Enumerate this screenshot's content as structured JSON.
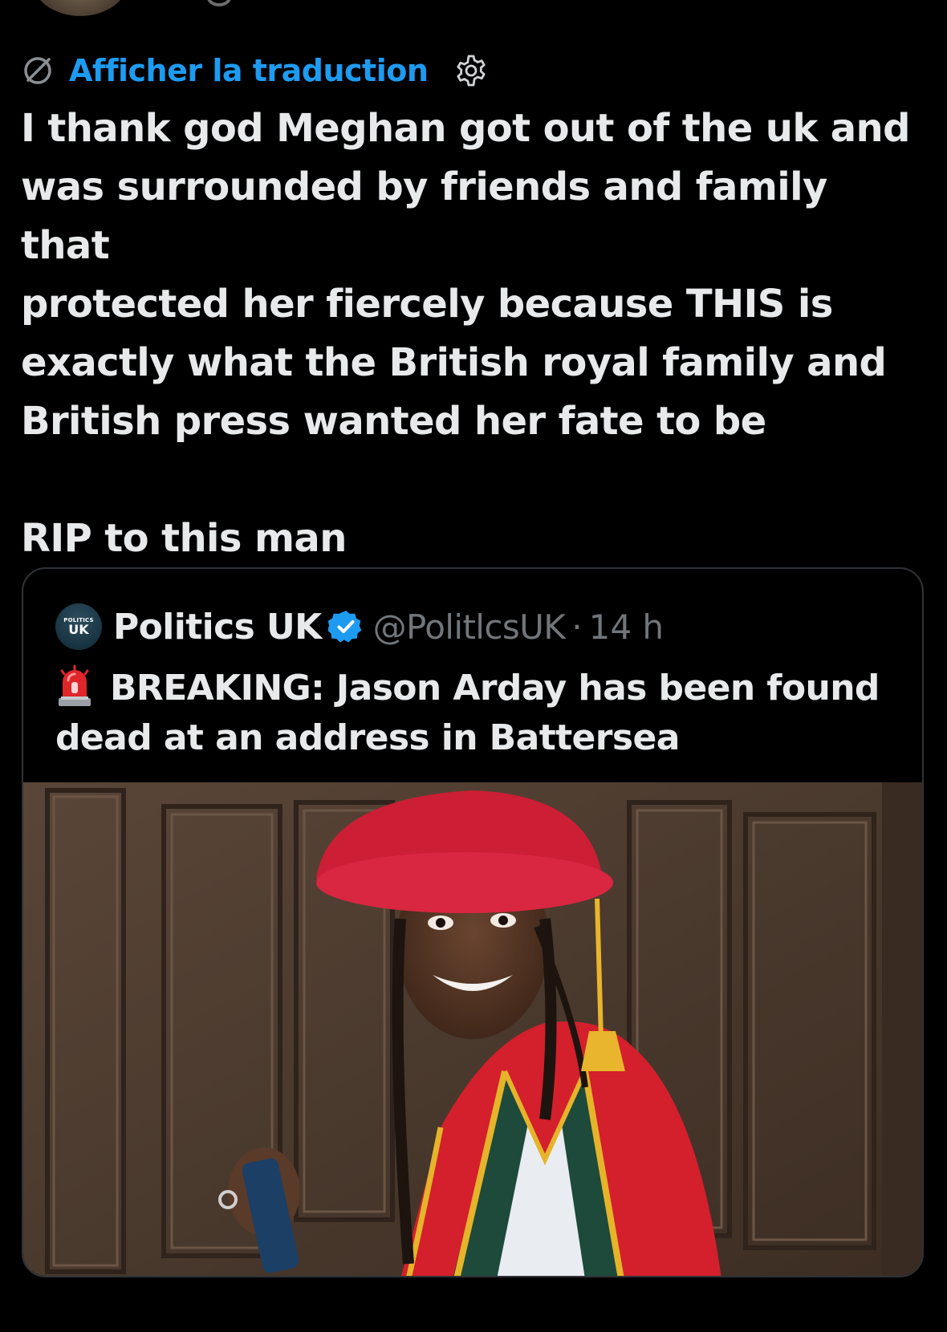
{
  "translation": {
    "label": "Afficher la traduction",
    "icon": "translate-icon",
    "settings_icon": "gear-icon"
  },
  "tweet": {
    "text": "I thank god Meghan got out of the uk and\nwas surrounded by friends and family that\nprotected her fiercely because THIS is\nexactly what the British royal family and\nBritish press wanted her fate to be\n\nRIP to this man"
  },
  "quote": {
    "avatar_top": "POLITICS",
    "avatar_bottom": "UK",
    "name": "Politics UK",
    "verified_icon": "verified-badge-icon",
    "handle": "@PolitlcsUK",
    "separator": "·",
    "time": "14 h",
    "emoji_icon": "siren-icon",
    "text": "BREAKING: Jason Arday has been found dead at an address in Battersea",
    "image": "photo of a smiling man in red academic gown and red bonnet with gold tassel, wood panelled wall behind"
  },
  "colors": {
    "background": "#000000",
    "text": "#e7e9ea",
    "link": "#1d9bf0",
    "muted": "#71767b",
    "border": "#2f3336",
    "verified": "#1d9bf0"
  }
}
